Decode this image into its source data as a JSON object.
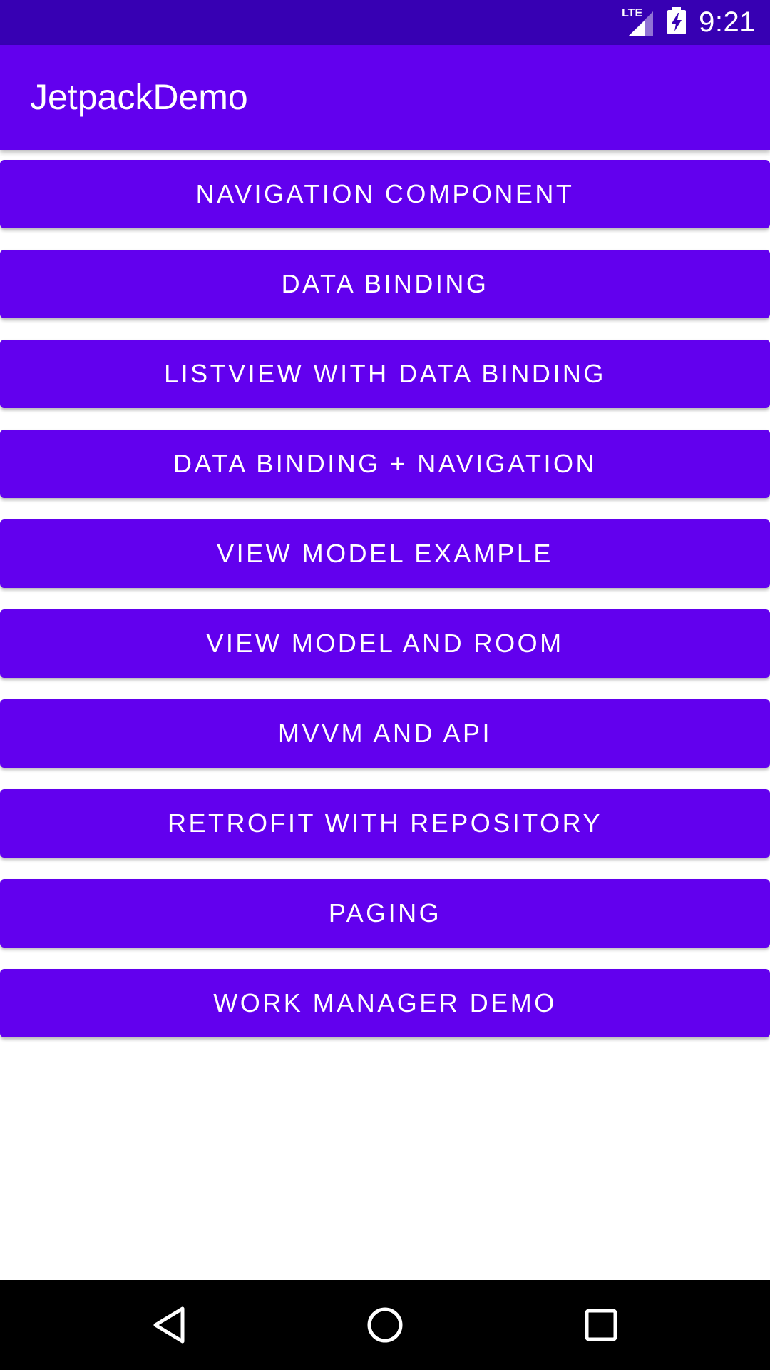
{
  "status_bar": {
    "time": "9:21",
    "network_label": "LTE",
    "icons": [
      "lte-signal-icon",
      "battery-charging-icon"
    ]
  },
  "app_bar": {
    "title": "JetpackDemo"
  },
  "buttons": [
    {
      "label": "NAVIGATION COMPONENT"
    },
    {
      "label": "DATA BINDING"
    },
    {
      "label": "LISTVIEW WITH DATA BINDING"
    },
    {
      "label": "DATA BINDING + NAVIGATION"
    },
    {
      "label": "VIEW MODEL EXAMPLE"
    },
    {
      "label": "VIEW MODEL AND ROOM"
    },
    {
      "label": "MVVM AND API"
    },
    {
      "label": "RETROFIT WITH REPOSITORY"
    },
    {
      "label": "PAGING"
    },
    {
      "label": "WORK MANAGER DEMO"
    }
  ],
  "nav_bar": {
    "icons": [
      "back-icon",
      "home-icon",
      "recents-icon"
    ]
  },
  "colors": {
    "primary": "#6200EE",
    "primary_dark": "#3700B3",
    "on_primary": "#FFFFFF",
    "nav_bar": "#000000"
  }
}
